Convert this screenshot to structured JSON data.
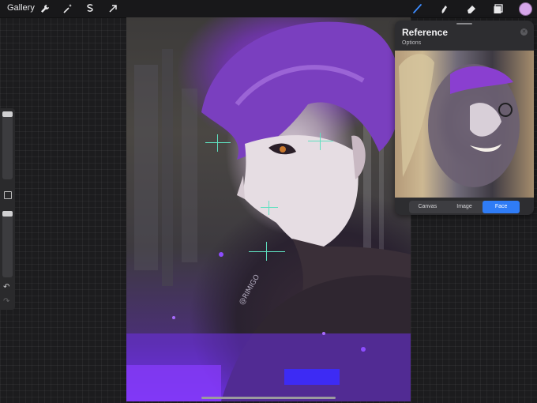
{
  "toolbar": {
    "gallery_label": "Gallery",
    "left_tools": [
      "wrench-icon",
      "magic-wand-icon",
      "selection-icon",
      "transform-arrow-icon"
    ],
    "right_tools": [
      "brush-icon",
      "smudge-icon",
      "eraser-icon",
      "layers-icon"
    ],
    "active_tool": "brush-icon",
    "color": "#d6a6ea",
    "accent": "#2f7cf6"
  },
  "sidebar": {
    "brush_size_slider": "slider",
    "modify_button": "square-icon",
    "opacity_slider": "slider",
    "undo_icon": "undo-icon",
    "redo_icon": "redo-icon"
  },
  "artwork": {
    "signature": "@RIMIGO"
  },
  "reference": {
    "title": "Reference",
    "options_label": "Options",
    "tabs": [
      {
        "label": "Canvas",
        "active": false
      },
      {
        "label": "Image",
        "active": false
      },
      {
        "label": "Face",
        "active": true
      }
    ]
  }
}
